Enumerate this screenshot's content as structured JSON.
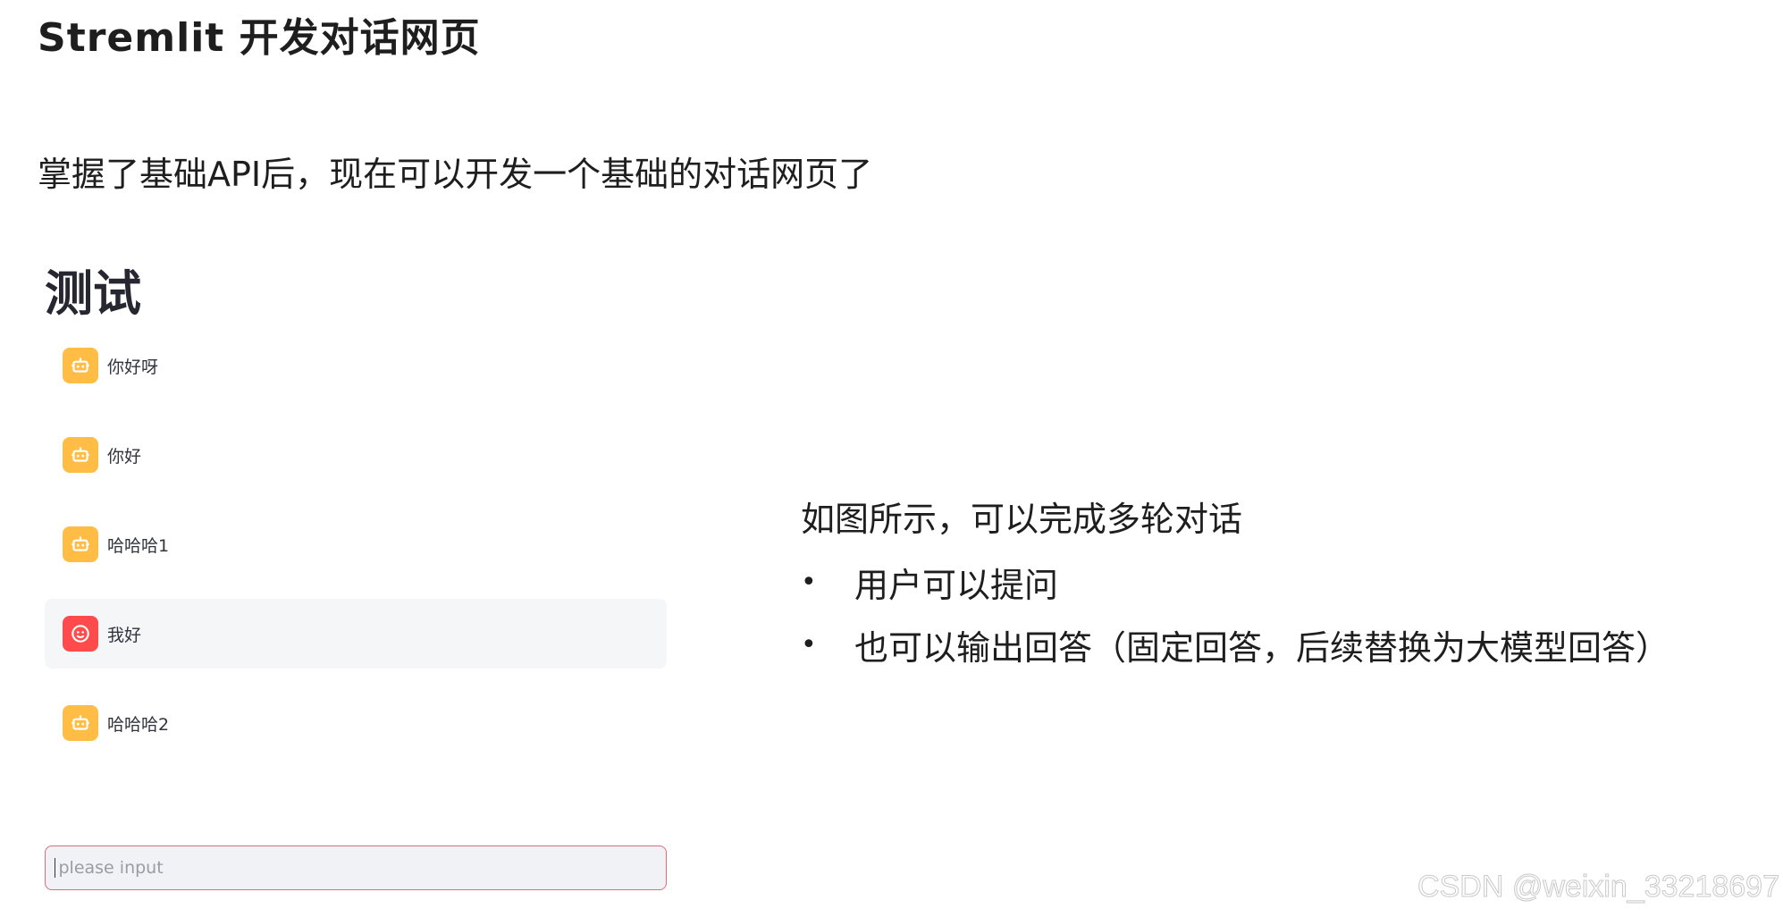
{
  "slide": {
    "title": "Stremlit 开发对话网页",
    "intro": "掌握了基础API后，现在可以开发一个基础的对话网页了"
  },
  "app": {
    "title": "测试",
    "messages": [
      {
        "role": "assistant",
        "text": "你好呀"
      },
      {
        "role": "assistant",
        "text": "你好"
      },
      {
        "role": "assistant",
        "text": "哈哈哈1"
      },
      {
        "role": "user",
        "text": "我好"
      },
      {
        "role": "assistant",
        "text": "哈哈哈2"
      }
    ],
    "input": {
      "placeholder": "please input",
      "value": ""
    },
    "icons": {
      "assistant": "robot-icon",
      "user": "smiley-face-icon"
    },
    "colors": {
      "assistant_avatar": "#ffbd45",
      "user_avatar": "#ff4b4b",
      "input_border": "#e06c7a"
    }
  },
  "notes": {
    "heading": "如图所示，可以完成多轮对话",
    "bullets": [
      "用户可以提问",
      "也可以输出回答（固定回答，后续替换为大模型回答）"
    ]
  },
  "watermark": "CSDN @weixin_33218697"
}
